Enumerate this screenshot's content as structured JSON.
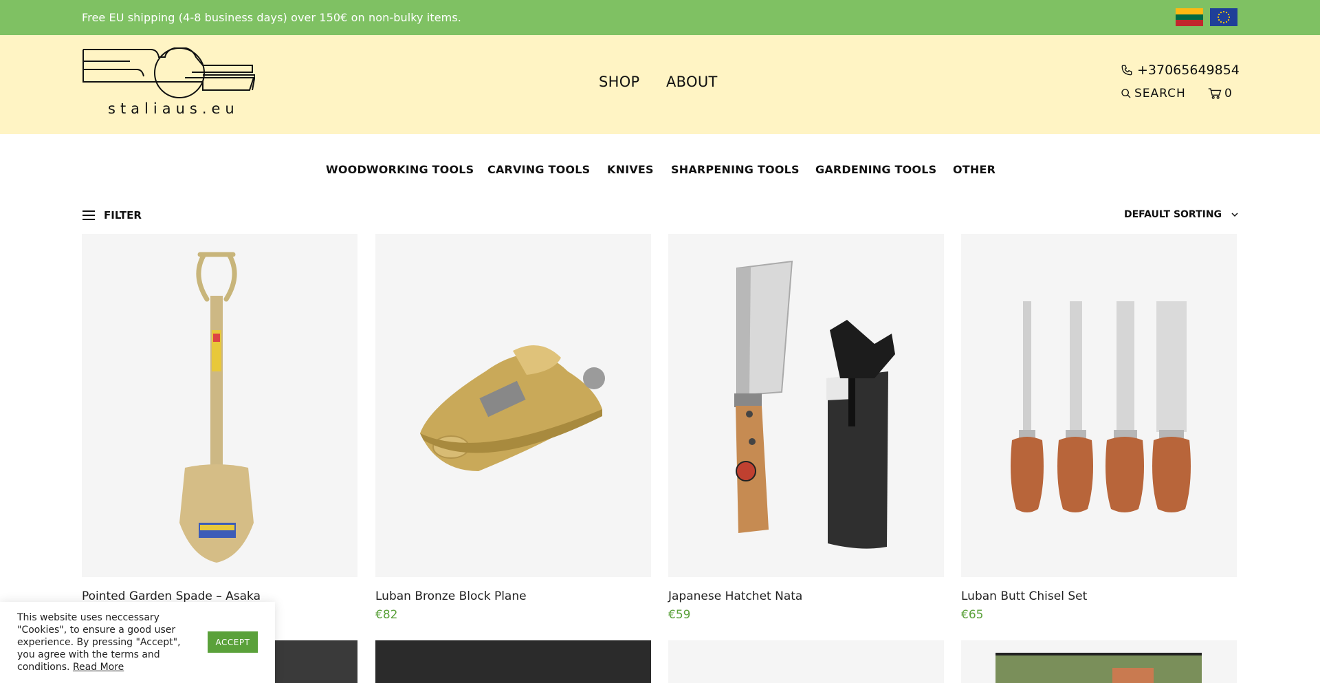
{
  "topbar": {
    "shipping_text": "Free EU shipping (4-8 business days) over 150€ on non-bulky items. ",
    "flags": [
      {
        "icon": "lithuania-flag-icon",
        "colors": [
          "#fdb913",
          "#006a44",
          "#c1272d"
        ]
      },
      {
        "icon": "eu-flag-icon",
        "colors": [
          "#1f3f98",
          "#ffcc00"
        ]
      }
    ],
    "background_color": "#7fc163"
  },
  "header": {
    "logo_text": "staliaus.eu",
    "nav": [
      {
        "label": "SHOP"
      },
      {
        "label": "ABOUT"
      }
    ],
    "phone": "+37065649854",
    "search_label": "SEARCH",
    "cart_count": "0",
    "background_color": "#fff4c4"
  },
  "categories": [
    {
      "label": "WOODWORKING TOOLS"
    },
    {
      "label": "CARVING TOOLS"
    },
    {
      "label": "KNIVES"
    },
    {
      "label": "SHARPENING TOOLS"
    },
    {
      "label": "GARDENING TOOLS"
    },
    {
      "label": "OTHER"
    }
  ],
  "toolbar": {
    "filter_label": "FILTER",
    "sorting_label": "DEFAULT SORTING"
  },
  "products": [
    {
      "title": "Pointed Garden Spade – Asaka",
      "price": "",
      "image": "garden-spade"
    },
    {
      "title": "Luban Bronze Block Plane",
      "price": "€82",
      "image": "block-plane"
    },
    {
      "title": "Japanese Hatchet Nata",
      "price": "€59",
      "image": "hatchet-nata"
    },
    {
      "title": "Luban Butt Chisel Set",
      "price": "€65",
      "image": "chisel-set"
    }
  ],
  "cookie": {
    "text": "This website uses neccessary \"Cookies\", to ensure a good user experience. By pressing \"Accept\", you agree with the terms and conditions.",
    "read_more": "Read More",
    "accept_label": "ACCEPT"
  },
  "colors": {
    "accent_green": "#5aa13a",
    "price_green": "#5aa13a"
  }
}
